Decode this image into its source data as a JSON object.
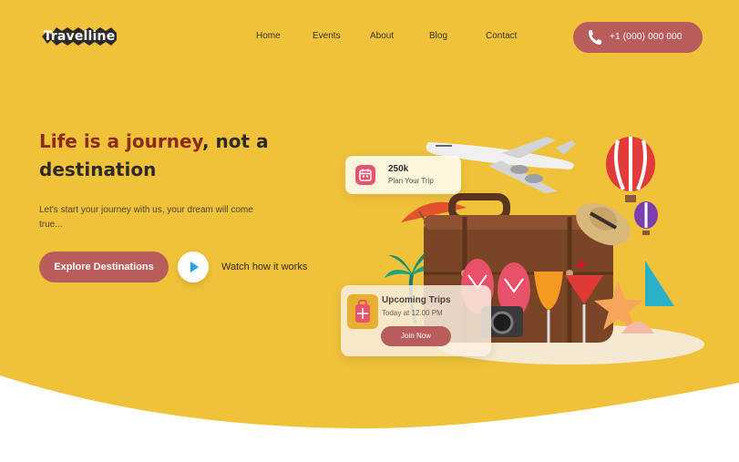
{
  "brand": {
    "name": "Travelline"
  },
  "nav": {
    "items": [
      "Home",
      "Events",
      "About",
      "Blog",
      "Contact"
    ]
  },
  "header": {
    "phone": "+1 (000) 000 000"
  },
  "hero": {
    "headline_accent": "Life is a journey",
    "headline_rest": ", not a destination",
    "subtext": "Let's start your journey with us, your dream will come true...",
    "cta_label": "Explore Destinations",
    "watch_label": "Watch how it works"
  },
  "stat_card": {
    "value": "250k",
    "label": "Plan Your Trip"
  },
  "trip_card": {
    "title": "Upcoming Trips",
    "subtitle": "Today at 12.00 PM",
    "button": "Join Now"
  },
  "colors": {
    "background": "#f0c23a",
    "accent": "#b85d5c",
    "headline_accent": "#8b2a1f",
    "text": "#2e2a27"
  },
  "icons": [
    "phone-icon",
    "play-icon",
    "calendar-icon",
    "suitcase-icon"
  ]
}
